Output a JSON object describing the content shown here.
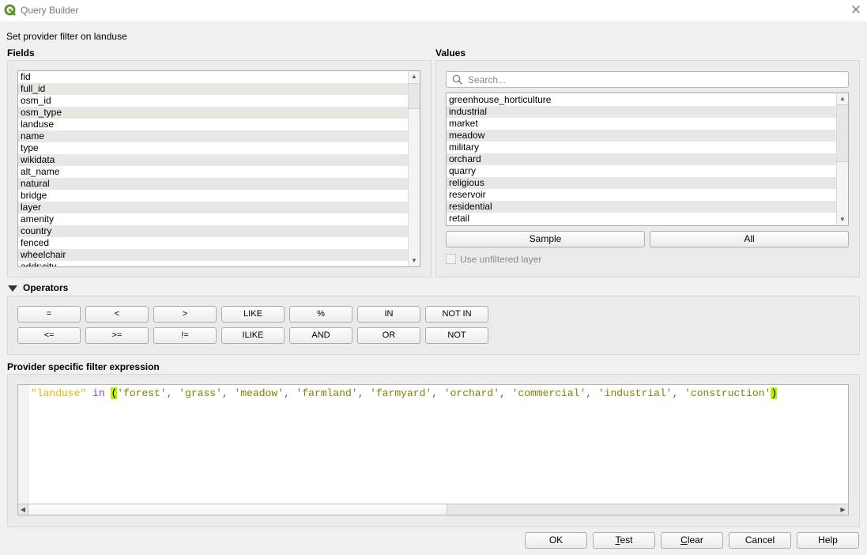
{
  "window": {
    "title": "Query Builder",
    "close_icon": "close-icon",
    "app_icon": "qgis-logo-icon"
  },
  "subtitle": "Set provider filter on landuse",
  "fields": {
    "label": "Fields",
    "items": [
      "fid",
      "full_id",
      "osm_id",
      "osm_type",
      "landuse",
      "name",
      "type",
      "wikidata",
      "alt_name",
      "natural",
      "bridge",
      "layer",
      "amenity",
      "country",
      "fenced",
      "wheelchair",
      "addr:city"
    ]
  },
  "values": {
    "label": "Values",
    "search_placeholder": "Search...",
    "search_value": "",
    "items": [
      "greenhouse_horticulture",
      "industrial",
      "market",
      "meadow",
      "military",
      "orchard",
      "quarry",
      "religious",
      "reservoir",
      "residential",
      "retail"
    ],
    "sample_label": "Sample",
    "all_label": "All",
    "use_unfiltered_label": "Use unfiltered layer",
    "use_unfiltered_checked": false
  },
  "operators": {
    "label": "Operators",
    "row1": [
      "=",
      "<",
      ">",
      "LIKE",
      "%",
      "IN",
      "NOT IN"
    ],
    "row2": [
      "<=",
      ">=",
      "!=",
      "ILIKE",
      "AND",
      "OR",
      "NOT"
    ]
  },
  "expression": {
    "label": "Provider specific filter expression",
    "tokens": [
      {
        "t": "field",
        "v": "\"landuse\""
      },
      {
        "t": "plain",
        "v": " "
      },
      {
        "t": "kw",
        "v": "in"
      },
      {
        "t": "plain",
        "v": " "
      },
      {
        "t": "brace",
        "v": "("
      },
      {
        "t": "str",
        "v": "'forest'"
      },
      {
        "t": "punc",
        "v": ", "
      },
      {
        "t": "str",
        "v": "'grass'"
      },
      {
        "t": "punc",
        "v": ", "
      },
      {
        "t": "str",
        "v": "'meadow'"
      },
      {
        "t": "punc",
        "v": ", "
      },
      {
        "t": "str",
        "v": "'farmland'"
      },
      {
        "t": "punc",
        "v": ", "
      },
      {
        "t": "str",
        "v": "'farmyard'"
      },
      {
        "t": "punc",
        "v": ", "
      },
      {
        "t": "str",
        "v": "'orchard'"
      },
      {
        "t": "punc",
        "v": ", "
      },
      {
        "t": "str",
        "v": "'commercial'"
      },
      {
        "t": "punc",
        "v": ", "
      },
      {
        "t": "str",
        "v": "'industrial'"
      },
      {
        "t": "punc",
        "v": ", "
      },
      {
        "t": "str",
        "v": "'construction'"
      },
      {
        "t": "brace",
        "v": ")"
      }
    ]
  },
  "buttons": {
    "ok": "OK",
    "test": "Test",
    "clear": "Clear",
    "cancel": "Cancel",
    "help": "Help"
  }
}
